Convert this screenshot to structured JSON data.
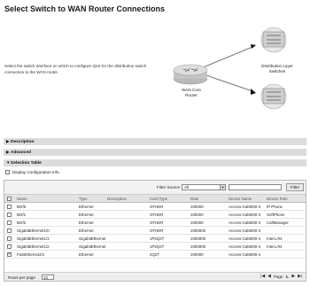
{
  "page": {
    "title": "Select Switch to WAN Router Connections",
    "description": "Select the switch interface on which to configure QoS for the distribution switch connection to the WAN router."
  },
  "diagram": {
    "router_label_1": "WAN Core",
    "router_label_2": "Router",
    "switch_label_1": "Distribution Layer",
    "switch_label_2": "Switches"
  },
  "sections": {
    "description": "Description",
    "advanced": "Advanced",
    "selection_table": "Selection Table",
    "display_config": "Display Configuration Info."
  },
  "filter": {
    "label": "Filter Source",
    "selected": "All",
    "value": "",
    "button": "Filter"
  },
  "table": {
    "columns": [
      "Name",
      "Type",
      "Description",
      "Card Type",
      "Rate",
      "Device Name",
      "Device Role"
    ],
    "rows": [
      {
        "checked": false,
        "name": "BGf5",
        "type": "Ethernet",
        "desc": "",
        "card": "OTHER",
        "rate": "100000",
        "device": "Access-Cat6000-3",
        "role": "IP Phone"
      },
      {
        "checked": false,
        "name": "BGf1",
        "type": "Ethernet",
        "desc": "",
        "card": "OTHER",
        "rate": "100000",
        "device": "Access-Cat6000-3",
        "role": "SoftPhone"
      },
      {
        "checked": false,
        "name": "BGf2",
        "type": "Ethernet",
        "desc": "",
        "card": "OTHER",
        "rate": "100000",
        "device": "Access-Cat6000-3",
        "role": "CallManager"
      },
      {
        "checked": false,
        "name": "GigabitEthernet1/0",
        "type": "Ethernet",
        "desc": "",
        "card": "OTHER",
        "rate": "1000000",
        "device": "Access-Cat6000-3",
        "role": ""
      },
      {
        "checked": false,
        "name": "GigabitEthernet1/1",
        "type": "GigabitEthernet",
        "desc": "",
        "card": "1P2Q2T",
        "rate": "1000000",
        "device": "Access-Cat6000-4",
        "role": "InterLAN"
      },
      {
        "checked": false,
        "name": "GigabitEthernet1/2",
        "type": "GigabitEthernet",
        "desc": "",
        "card": "1P2Q2T",
        "rate": "1000000",
        "device": "Access-Cat6000-4",
        "role": "InterLAN"
      },
      {
        "checked": true,
        "name": "FastEthernet2/1",
        "type": "Ethernet",
        "desc": "",
        "card": "2Q2T",
        "rate": "100000",
        "device": "Access-Cat6000-4",
        "role": ""
      }
    ]
  },
  "footer": {
    "rows_per_page_label": "Rows per page",
    "rows_per_page": "10",
    "page_label": "Page",
    "page_number": "1."
  }
}
